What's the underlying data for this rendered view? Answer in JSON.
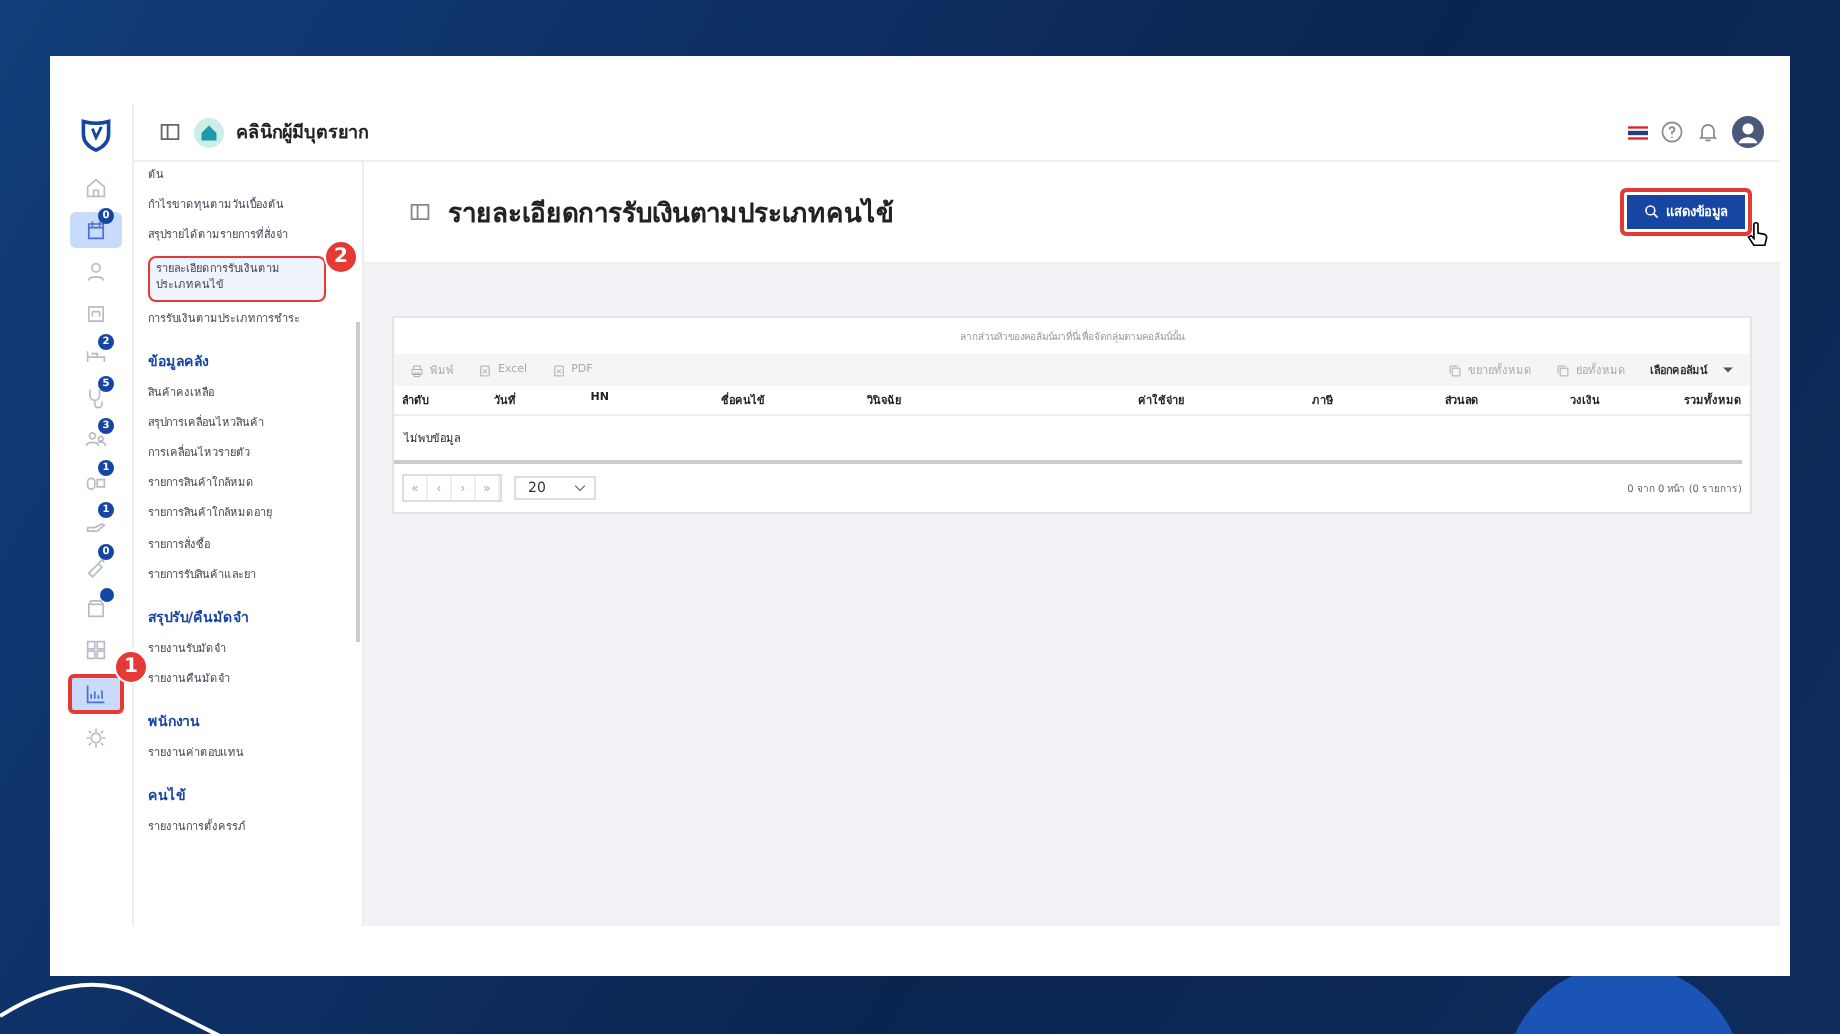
{
  "app_bar": {
    "clinic_name": "คลินิกผู้มีบุตรยาก"
  },
  "rail": [
    {
      "selected": false
    },
    {
      "badge": "0",
      "selected": true
    },
    {
      "selected": false
    },
    {
      "selected": false
    },
    {
      "badge": "2",
      "selected": false
    },
    {
      "badge": "5",
      "selected": false
    },
    {
      "badge": "3",
      "selected": false
    },
    {
      "badge": "1",
      "selected": false
    },
    {
      "badge": "1",
      "selected": false
    },
    {
      "badge": "0",
      "selected": false
    },
    {
      "dot": true,
      "selected": false
    },
    {
      "selected": false
    },
    {
      "selected": true,
      "callout": "1"
    },
    {
      "selected": false
    }
  ],
  "sidebar": {
    "sections": [
      {
        "items": [
          {
            "label": "ต้น",
            "selected": false
          },
          {
            "label": "กำไรขาดทุนตามวันเบื้องต้น",
            "selected": false
          },
          {
            "label": "สรุปรายได้ตามรายการที่สั่งจ่า",
            "selected": false
          },
          {
            "label": "รายละเอียดการรับเงินตามประเภทคนไข้",
            "selected": true,
            "callout": "2"
          },
          {
            "label": "การรับเงินตามประเภทการชำระ",
            "selected": false
          }
        ]
      },
      {
        "heading": "ข้อมูลคลัง",
        "items": [
          {
            "label": "สินค้าคงเหลือ",
            "selected": false
          },
          {
            "label": "สรุปการเคลื่อนไหวสินค้า",
            "selected": false
          },
          {
            "label": "การเคลื่อนไหวรายตัว",
            "selected": false
          },
          {
            "label": "รายการสินค้าใกล้หมด",
            "selected": false
          },
          {
            "label": "รายการสินค้าใกล้หมดอายุ",
            "selected": false
          },
          {
            "label": "รายการสั่งซื้อ",
            "selected": false
          },
          {
            "label": "รายการรับสินค้าและยา",
            "selected": false
          }
        ]
      },
      {
        "heading": "สรุปรับ/คืนมัดจำ",
        "items": [
          {
            "label": "รายงานรับมัดจำ",
            "selected": false
          },
          {
            "label": "รายงานคืนมัดจำ",
            "selected": false
          }
        ]
      },
      {
        "heading": "พนักงาน",
        "items": [
          {
            "label": "รายงานค่าตอบแทน",
            "selected": false
          }
        ]
      },
      {
        "heading": "คนไข้",
        "items": [
          {
            "label": "รายงานการตั้งครรภ์",
            "selected": false
          }
        ]
      }
    ]
  },
  "page": {
    "title": "รายละเอียดการรับเงินตามประเภทคนไข้",
    "show_button": {
      "label": "แสดงข้อมูล",
      "highlighted": true
    }
  },
  "grid": {
    "group_hint": "ลากส่วนหัวของคอลัมน์มาที่นี่เพื่อจัดกลุ่มตามคอลัมน์นั้น",
    "toolbar_left": [
      {
        "label": "พิมพ์",
        "disabled": true
      },
      {
        "label": "Excel",
        "disabled": true
      },
      {
        "label": "PDF",
        "disabled": true
      }
    ],
    "toolbar_right": [
      {
        "label": "ขยายทั้งหมด",
        "disabled": true
      },
      {
        "label": "ย่อทั้งหมด",
        "disabled": true
      }
    ],
    "column_chooser": "เลือกคอลัมน์",
    "columns": [
      "ลำดับ",
      "วันที่",
      "HN",
      "ชื่อคนไข้",
      "วินิจฉัย",
      "ค่าใช้จ่าย",
      "ภาษี",
      "ส่วนลด",
      "วงเงิน",
      "รวมทั้งหมด"
    ],
    "empty_text": "ไม่พบข้อมูล",
    "pager": {
      "buttons": [
        "«",
        "‹",
        "›",
        "»"
      ],
      "page_size": "20",
      "summary": "0 จาก 0 หน้า (0 รายการ)"
    }
  }
}
